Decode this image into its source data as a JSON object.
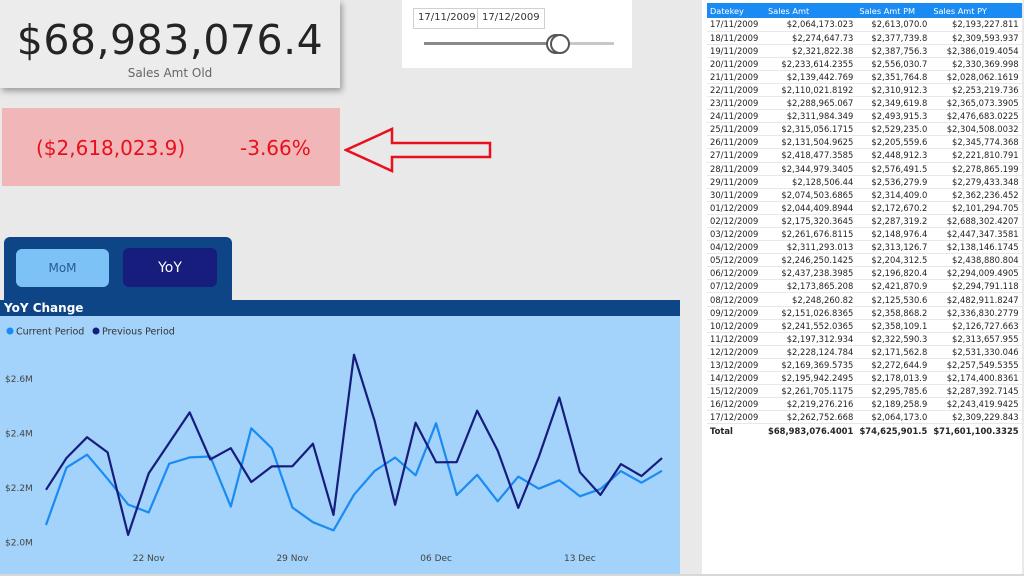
{
  "kpi": {
    "value": "$68,983,076.4",
    "label": "Sales Amt Old"
  },
  "diff": {
    "value": "($2,618,023.9)",
    "percent": "-3.66%",
    "color": "#e8101c"
  },
  "slicer": {
    "start_date": "17/11/2009",
    "end_date": "17/12/2009"
  },
  "toggle": {
    "mom_label": "MoM",
    "yoy_label": "YoY",
    "active": "YoY"
  },
  "chart_data": {
    "type": "line",
    "title": "YoY Change",
    "legend": {
      "position": "top-left"
    },
    "x": [
      "17/11/2009",
      "18/11/2009",
      "19/11/2009",
      "20/11/2009",
      "21/11/2009",
      "22/11/2009",
      "23/11/2009",
      "24/11/2009",
      "25/11/2009",
      "26/11/2009",
      "27/11/2009",
      "28/11/2009",
      "29/11/2009",
      "30/11/2009",
      "01/12/2009",
      "02/12/2009",
      "03/12/2009",
      "04/12/2009",
      "05/12/2009",
      "06/12/2009",
      "07/12/2009",
      "08/12/2009",
      "09/12/2009",
      "10/12/2009",
      "11/12/2009",
      "12/12/2009",
      "13/12/2009",
      "14/12/2009",
      "15/12/2009",
      "16/12/2009",
      "17/12/2009"
    ],
    "x_ticks": [
      "22 Nov",
      "29 Nov",
      "06 Dec",
      "13 Dec"
    ],
    "x_tick_dates": [
      "22/11/2009",
      "29/11/2009",
      "06/12/2009",
      "13/12/2009"
    ],
    "y_ticks": [
      "$2.0M",
      "$2.2M",
      "$2.4M",
      "$2.6M"
    ],
    "y_tick_values": [
      2000000,
      2200000,
      2400000,
      2600000
    ],
    "ylim": [
      1980000,
      2720000
    ],
    "series": [
      {
        "name": "Current Period",
        "color": "#1a8bf3",
        "values": [
          2064173.023,
          2274647.73,
          2321822.38,
          2233614.2355,
          2139442.769,
          2110021.8192,
          2288965.067,
          2311984.349,
          2315056.1715,
          2131504.9625,
          2418477.3585,
          2344979.3405,
          2128506.44,
          2074503.6865,
          2044409.8944,
          2175320.3645,
          2261676.8115,
          2311293.013,
          2246250.1425,
          2437238.3985,
          2173865.208,
          2248260.82,
          2151026.8365,
          2241552.0365,
          2197312.934,
          2228124.784,
          2169369.5735,
          2195942.2495,
          2261705.1175,
          2219276.216,
          2262752.668
        ]
      },
      {
        "name": "Previous Period",
        "color": "#161d7d",
        "values": [
          2193227.811,
          2309593.937,
          2386019.4054,
          2330369.998,
          2028062.1619,
          2253219.736,
          2365073.3905,
          2476683.0225,
          2304508.0032,
          2345774.368,
          2221810.791,
          2278865.199,
          2279433.348,
          2362236.452,
          2101294.705,
          2688302.4207,
          2447347.3581,
          2138146.1745,
          2438880.804,
          2294009.4905,
          2294791.118,
          2482911.8247,
          2336830.2779,
          2126727.663,
          2313657.955,
          2531330.046,
          2257549.5355,
          2174400.8361,
          2287392.7145,
          2243419.9425,
          2309229.843
        ]
      }
    ]
  },
  "table": {
    "headers": [
      "Datekey",
      "Sales Amt",
      "Sales Amt PM",
      "Sales Amt PY"
    ],
    "rows": [
      [
        "17/11/2009",
        "$2,064,173.023",
        "$2,613,070.0",
        "$2,193,227.811"
      ],
      [
        "18/11/2009",
        "$2,274,647.73",
        "$2,377,739.8",
        "$2,309,593.937"
      ],
      [
        "19/11/2009",
        "$2,321,822.38",
        "$2,387,756.3",
        "$2,386,019.4054"
      ],
      [
        "20/11/2009",
        "$2,233,614.2355",
        "$2,556,030.7",
        "$2,330,369.998"
      ],
      [
        "21/11/2009",
        "$2,139,442.769",
        "$2,351,764.8",
        "$2,028,062.1619"
      ],
      [
        "22/11/2009",
        "$2,110,021.8192",
        "$2,310,912.3",
        "$2,253,219.736"
      ],
      [
        "23/11/2009",
        "$2,288,965.067",
        "$2,349,619.8",
        "$2,365,073.3905"
      ],
      [
        "24/11/2009",
        "$2,311,984.349",
        "$2,493,915.3",
        "$2,476,683.0225"
      ],
      [
        "25/11/2009",
        "$2,315,056.1715",
        "$2,529,235.0",
        "$2,304,508.0032"
      ],
      [
        "26/11/2009",
        "$2,131,504.9625",
        "$2,205,559.6",
        "$2,345,774.368"
      ],
      [
        "27/11/2009",
        "$2,418,477.3585",
        "$2,448,912.3",
        "$2,221,810.791"
      ],
      [
        "28/11/2009",
        "$2,344,979.3405",
        "$2,576,491.5",
        "$2,278,865.199"
      ],
      [
        "29/11/2009",
        "$2,128,506.44",
        "$2,536,279.9",
        "$2,279,433.348"
      ],
      [
        "30/11/2009",
        "$2,074,503.6865",
        "$2,314,409.0",
        "$2,362,236.452"
      ],
      [
        "01/12/2009",
        "$2,044,409.8944",
        "$2,172,670.2",
        "$2,101,294.705"
      ],
      [
        "02/12/2009",
        "$2,175,320.3645",
        "$2,287,319.2",
        "$2,688,302.4207"
      ],
      [
        "03/12/2009",
        "$2,261,676.8115",
        "$2,148,976.4",
        "$2,447,347.3581"
      ],
      [
        "04/12/2009",
        "$2,311,293.013",
        "$2,313,126.7",
        "$2,138,146.1745"
      ],
      [
        "05/12/2009",
        "$2,246,250.1425",
        "$2,204,312.5",
        "$2,438,880.804"
      ],
      [
        "06/12/2009",
        "$2,437,238.3985",
        "$2,196,820.4",
        "$2,294,009.4905"
      ],
      [
        "07/12/2009",
        "$2,173,865.208",
        "$2,421,870.9",
        "$2,294,791.118"
      ],
      [
        "08/12/2009",
        "$2,248,260.82",
        "$2,125,530.6",
        "$2,482,911.8247"
      ],
      [
        "09/12/2009",
        "$2,151,026.8365",
        "$2,358,868.2",
        "$2,336,830.2779"
      ],
      [
        "10/12/2009",
        "$2,241,552.0365",
        "$2,358,109.1",
        "$2,126,727.663"
      ],
      [
        "11/12/2009",
        "$2,197,312.934",
        "$2,322,590.3",
        "$2,313,657.955"
      ],
      [
        "12/12/2009",
        "$2,228,124.784",
        "$2,171,562.8",
        "$2,531,330.046"
      ],
      [
        "13/12/2009",
        "$2,169,369.5735",
        "$2,272,644.9",
        "$2,257,549.5355"
      ],
      [
        "14/12/2009",
        "$2,195,942.2495",
        "$2,178,013.9",
        "$2,174,400.8361"
      ],
      [
        "15/12/2009",
        "$2,261,705.1175",
        "$2,295,785.6",
        "$2,287,392.7145"
      ],
      [
        "16/12/2009",
        "$2,219,276.216",
        "$2,189,258.9",
        "$2,243,419.9425"
      ],
      [
        "17/12/2009",
        "$2,262,752.668",
        "$2,064,173.0",
        "$2,309,229.843"
      ]
    ],
    "total": [
      "Total",
      "$68,983,076.4001",
      "$74,625,901.5",
      "$71,601,100.3325"
    ]
  }
}
